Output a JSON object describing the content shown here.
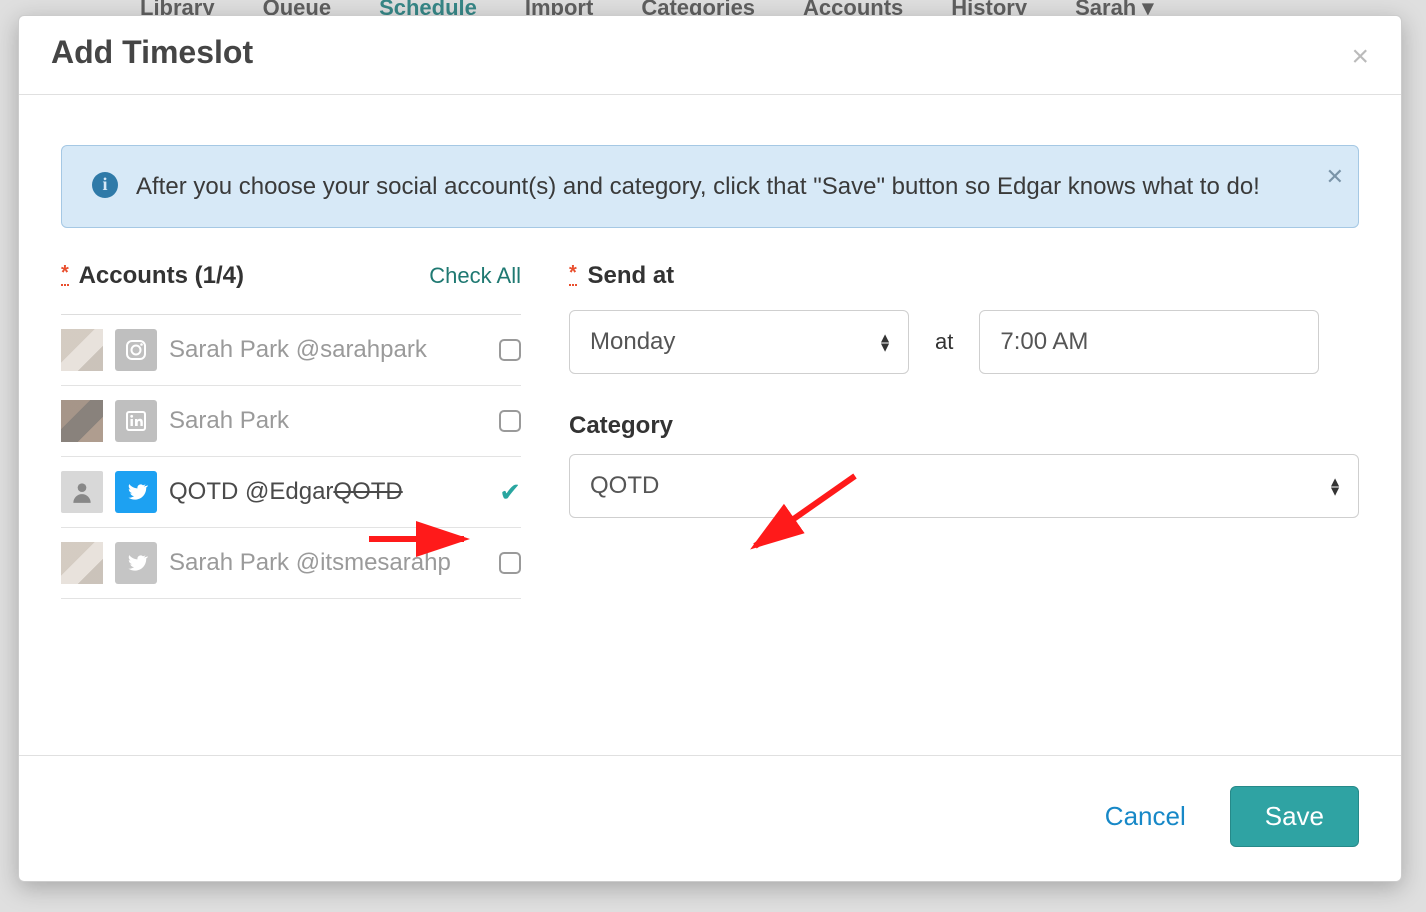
{
  "nav": {
    "items": [
      "Library",
      "Queue",
      "Schedule",
      "Import",
      "Categories",
      "Accounts",
      "History",
      "Sarah"
    ],
    "active_index": 2
  },
  "modal": {
    "title": "Add Timeslot",
    "close_glyph": "×"
  },
  "alert": {
    "text": "After you choose your social account(s) and category, click that \"Save\" button so Edgar knows what to do!",
    "info_glyph": "i",
    "dismiss_glyph": "✕"
  },
  "accounts": {
    "label_prefix": "Accounts",
    "count_display": "(1/4)",
    "check_all": "Check All",
    "items": [
      {
        "name": "Sarah Park @sarahpark",
        "network": "instagram",
        "checked": false,
        "active": false
      },
      {
        "name": "Sarah Park",
        "network": "linkedin",
        "checked": false,
        "active": false
      },
      {
        "name_main": "QOTD @Edgar",
        "name_strike": "QOTD",
        "network": "twitter",
        "checked": true,
        "active": true
      },
      {
        "name": "Sarah Park @itsmesarahp",
        "network": "twitter",
        "checked": false,
        "active": false
      }
    ]
  },
  "sendat": {
    "label": "Send at",
    "day": "Monday",
    "at_word": "at",
    "time": "7:00 AM"
  },
  "category": {
    "label": "Category",
    "value": "QOTD"
  },
  "footer": {
    "cancel": "Cancel",
    "save": "Save"
  }
}
